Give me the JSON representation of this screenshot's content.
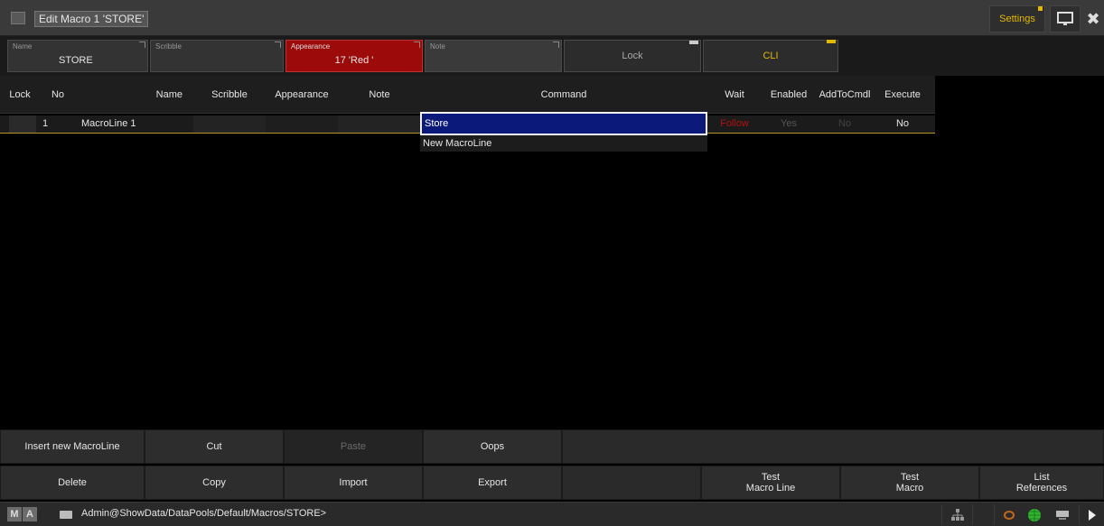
{
  "window": {
    "title": "Edit Macro 1 'STORE'",
    "settings_label": "Settings"
  },
  "props": {
    "name_label": "Name",
    "name_value": "STORE",
    "scribble_label": "Scribble",
    "scribble_value": "",
    "appearance_label": "Appearance",
    "appearance_value": "17 'Red '",
    "note_label": "Note",
    "note_value": "",
    "lock_label": "Lock",
    "cli_label": "CLI"
  },
  "table": {
    "headers": {
      "lock": "Lock",
      "no": "No",
      "name": "Name",
      "scribble": "Scribble",
      "appearance": "Appearance",
      "note": "Note",
      "command": "Command",
      "wait": "Wait",
      "enabled": "Enabled",
      "addtocmdl": "AddToCmdl",
      "execute": "Execute"
    },
    "rows": [
      {
        "no": "1",
        "name": "MacroLine 1",
        "command": "Store",
        "wait": "Follow",
        "enabled": "Yes",
        "addtocmdl": "No",
        "execute": "No"
      }
    ],
    "new_line_label": "New MacroLine"
  },
  "buttons": {
    "insert": "Insert new MacroLine",
    "cut": "Cut",
    "paste": "Paste",
    "oops": "Oops",
    "delete": "Delete",
    "copy": "Copy",
    "import": "Import",
    "export": "Export",
    "test_line_1": "Test",
    "test_line_2": "Macro Line",
    "test_macro_1": "Test",
    "test_macro_2": "Macro",
    "list_ref_1": "List",
    "list_ref_2": "References"
  },
  "status": {
    "logo_m": "M",
    "logo_a": "A",
    "command_line": "Admin@ShowData/DataPools/Default/Macros/STORE>"
  },
  "colors": {
    "accent": "#e5b800",
    "selection": "#0b1a7a",
    "appearance_red": "#9c0a0a",
    "wait_red": "#b01212"
  }
}
